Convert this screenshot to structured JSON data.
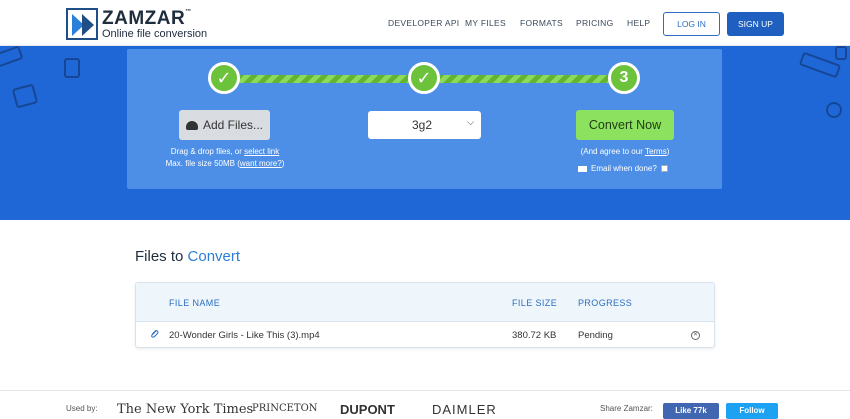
{
  "header": {
    "logo_name": "ZAMZAR",
    "logo_tm": "™",
    "logo_tagline": "Online file conversion",
    "nav": [
      "DEVELOPER API",
      "MY FILES",
      "FORMATS",
      "PRICING",
      "HELP"
    ],
    "login_label": "LOG IN",
    "signup_label": "SIGN UP"
  },
  "converter": {
    "step1": "✓",
    "step2": "✓",
    "step3": "3",
    "add_files_label": "Add Files...",
    "drag_prefix": "Drag & drop files, or ",
    "select_link": "select link",
    "max_size_prefix": "Max. file size 50MB (",
    "want_more": "want more?",
    "max_size_suffix": ")",
    "format_value": "3g2",
    "convert_label": "Convert Now",
    "agree_prefix": "(And agree to our ",
    "terms": "Terms",
    "agree_suffix": ")",
    "email_label": "Email when done?"
  },
  "files": {
    "title_prefix": "Files to ",
    "title_accent": "Convert",
    "columns": [
      "FILE NAME",
      "FILE SIZE",
      "PROGRESS"
    ],
    "rows": [
      {
        "name": "20-Wonder Girls - Like This (3).mp4",
        "size": "380.72 KB",
        "progress": "Pending"
      }
    ]
  },
  "footer": {
    "used_by": "Used by:",
    "press": [
      "The New York Times",
      "PRINCETON",
      "DUPONT",
      "DAIMLER"
    ],
    "share": "Share Zamzar:",
    "like": "Like 77k",
    "follow": "Follow"
  },
  "colors": {
    "brand_blue": "#1f67d6",
    "panel_blue": "#4d8fe6",
    "green": "#6cc23a",
    "convert_green": "#8ce25e"
  }
}
